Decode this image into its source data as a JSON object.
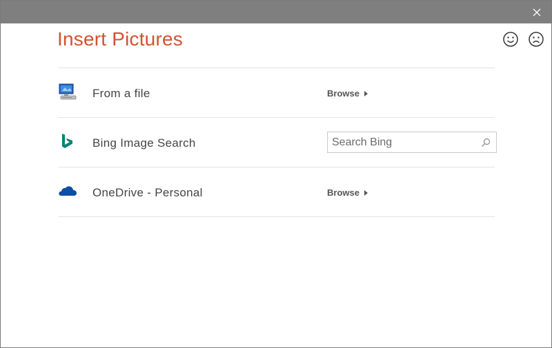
{
  "dialog": {
    "title": "Insert Pictures",
    "close_icon": "close-icon",
    "feedback": {
      "smile_icon": "smiley-icon",
      "frown_icon": "frown-icon"
    }
  },
  "sources": [
    {
      "label": "From a file",
      "icon": "computer-icon",
      "action_label": "Browse"
    },
    {
      "label": "Bing Image Search",
      "icon": "bing-icon",
      "search_placeholder": "Search Bing",
      "search_icon": "search-icon"
    },
    {
      "label": "OneDrive - Personal",
      "icon": "onedrive-cloud-icon",
      "action_label": "Browse"
    }
  ],
  "colors": {
    "title": "#d35230",
    "titlebar": "#7f7f7f",
    "bing": "#008373",
    "onedrive": "#0e4ea5"
  }
}
